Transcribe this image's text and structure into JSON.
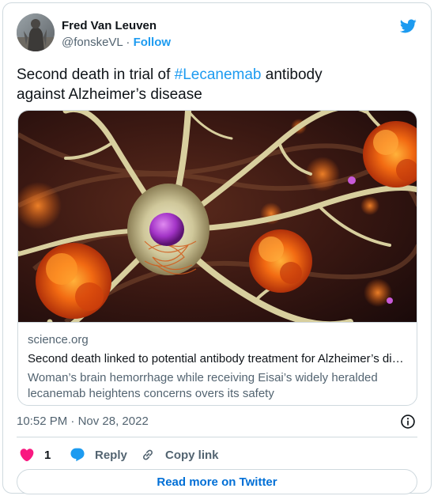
{
  "author": {
    "name": "Fred Van Leuven",
    "handle": "@fonskeVL",
    "separator": "·",
    "follow_label": "Follow",
    "avatar_icon": "avatar-photo"
  },
  "brand": {
    "logo_icon": "twitter-bird-icon",
    "color": "#1d9bf0"
  },
  "tweet": {
    "text_line1_before": "Second death in trial of ",
    "hashtag": "#Lecanemab",
    "text_line1_after": " antibody",
    "text_line2": "against Alzheimer’s disease"
  },
  "link_card": {
    "domain": "science.org",
    "title": "Second death linked to potential antibody treatment for Alzheimer’s disease",
    "description": "Woman’s brain hemorrhage while receiving Eisai’s widely heralded lecanemab heightens concerns overs its safety",
    "image_icon": "neuron-amyloid-plaque-illustration"
  },
  "meta": {
    "time": "10:52 PM",
    "separator": "·",
    "date": "Nov 28, 2022",
    "info_icon": "info-icon"
  },
  "actions": {
    "like_count": "1",
    "reply_label": "Reply",
    "copy_link_label": "Copy link",
    "like_color": "#f91880",
    "reply_color": "#1d9bf0"
  },
  "read_more_label": "Read more on Twitter"
}
